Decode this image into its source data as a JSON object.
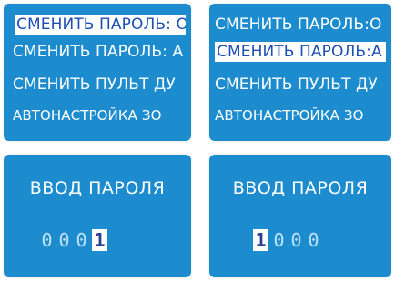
{
  "menu_screen_1": {
    "items": [
      {
        "label": "СМЕНИТЬ ПАРОЛЬ: О",
        "selected": true
      },
      {
        "label": "СМЕНИТЬ ПАРОЛЬ: А",
        "selected": false
      },
      {
        "label": "СМЕНИТЬ ПУЛЬТ ДУ",
        "selected": false
      },
      {
        "label": "АВТОНАСТРОЙКА ЗО",
        "selected": false
      }
    ]
  },
  "menu_screen_2": {
    "items": [
      {
        "label": "СМЕНИТЬ ПАРОЛЬ:О",
        "selected": false
      },
      {
        "label": "СМЕНИТЬ ПАРОЛЬ:А",
        "selected": true
      },
      {
        "label": "СМЕНИТЬ ПУЛЬТ ДУ",
        "selected": false
      },
      {
        "label": "АВТОНАСТРОЙКА ЗО",
        "selected": false
      }
    ]
  },
  "password_screen_1": {
    "title": "ВВОД ПАРОЛЯ",
    "digits": [
      "0",
      "0",
      "0",
      "1"
    ],
    "active_digit": 3
  },
  "password_screen_2": {
    "title": "ВВОД ПАРОЛЯ",
    "digits": [
      "1",
      "0",
      "0",
      "0"
    ],
    "active_digit": 0
  },
  "colors": {
    "screen_bg": "#1d8ccf",
    "text": "#ffffff",
    "selection_bg": "#ffffff",
    "selection_text": "#1d50b4"
  }
}
